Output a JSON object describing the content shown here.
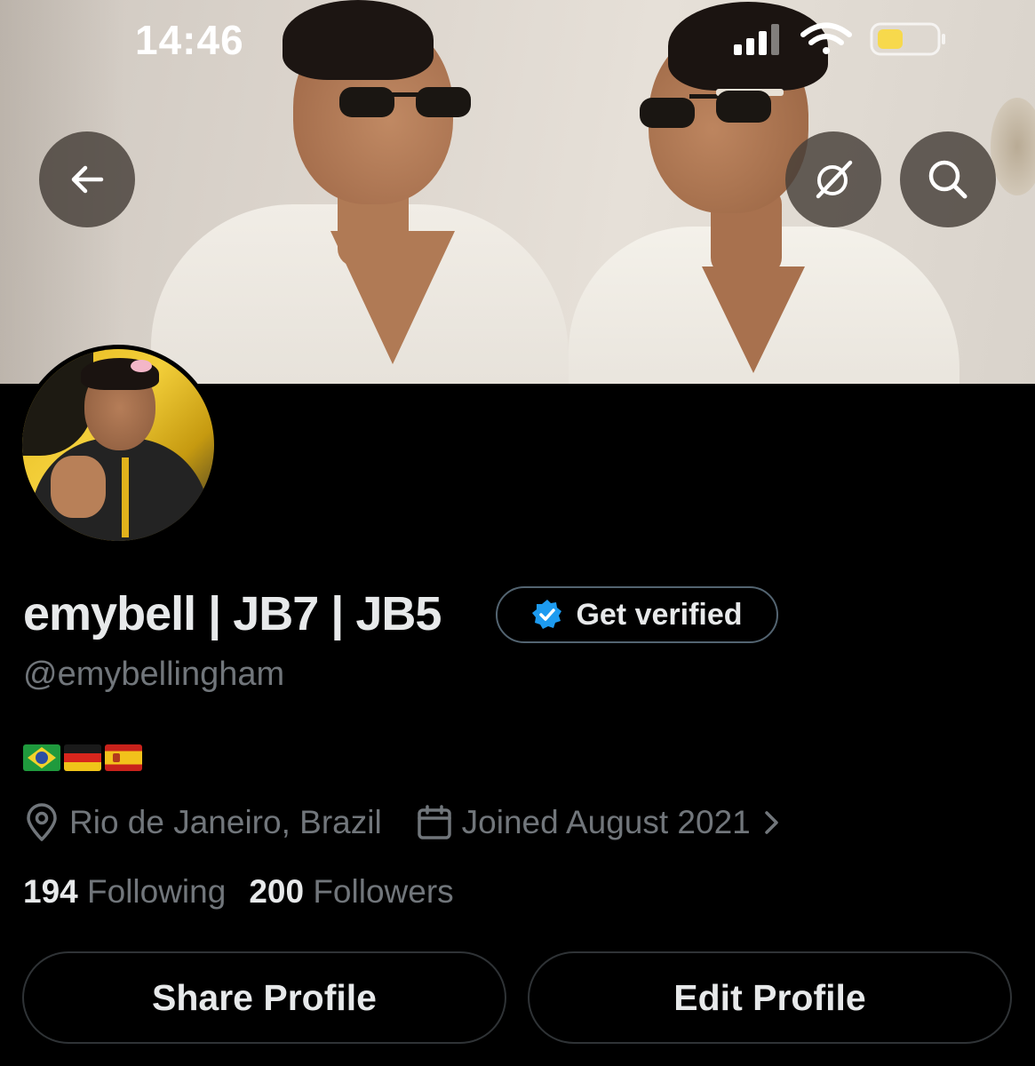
{
  "status_bar": {
    "time": "14:46",
    "icons": [
      "cellular-signal-icon",
      "wifi-icon",
      "battery-icon"
    ],
    "battery_color": "#f7d94c"
  },
  "banner": {
    "buttons": {
      "back": "arrow-left-icon",
      "grok": "grok-icon",
      "search": "search-icon"
    }
  },
  "profile": {
    "display_name": "emybell | JB7 | JB5",
    "handle": "@emybellingham",
    "verify_button": {
      "label": "Get verified",
      "icon": "verified-badge-icon",
      "icon_color": "#1d9bf0"
    },
    "bio": {
      "flags": [
        "Brazil",
        "Germany",
        "Spain"
      ]
    },
    "location": "Rio de Janeiro, Brazil",
    "joined": "Joined August 2021",
    "following_count": "194",
    "following_label": "Following",
    "followers_count": "200",
    "followers_label": "Followers"
  },
  "actions": {
    "share_label": "Share Profile",
    "edit_label": "Edit Profile"
  },
  "colors": {
    "background": "#000000",
    "primary_text": "#e7e9ea",
    "secondary_text": "#71767b",
    "border": "#2f3336"
  }
}
